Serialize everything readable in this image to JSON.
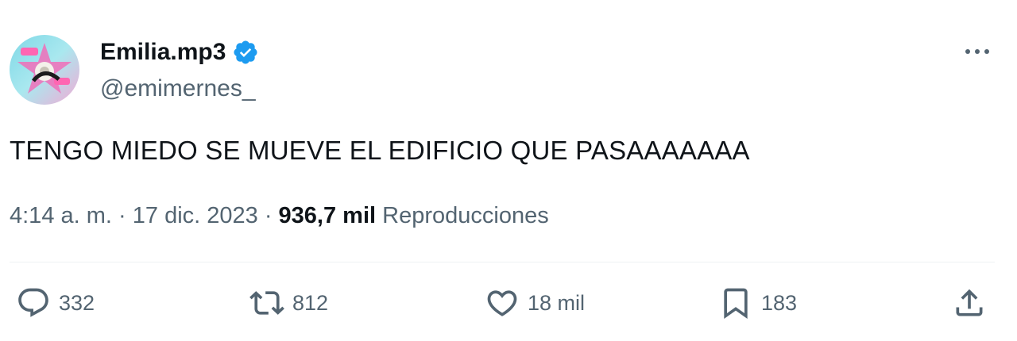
{
  "author": {
    "display_name": "Emilia.mp3",
    "handle": "@emimernes_",
    "verified": true,
    "avatar_icon": "profile-avatar"
  },
  "tweet": {
    "text": "TENGO MIEDO SE MUEVE EL EDIFICIO QUE PASAAAAAAA",
    "time": "4:14 a. m.",
    "date": "17 dic. 2023",
    "separator": " · ",
    "views_count": "936,7 mil",
    "views_label": "Reproducciones"
  },
  "actions": {
    "reply": {
      "icon": "reply-icon",
      "count": "332"
    },
    "retweet": {
      "icon": "retweet-icon",
      "count": "812"
    },
    "like": {
      "icon": "heart-icon",
      "count": "18 mil"
    },
    "bookmark": {
      "icon": "bookmark-icon",
      "count": "183"
    },
    "share": {
      "icon": "share-icon"
    }
  },
  "colors": {
    "text_primary": "#0f1419",
    "text_secondary": "#536471",
    "verified_blue": "#1d9bf0",
    "divider": "#eff3f4"
  }
}
